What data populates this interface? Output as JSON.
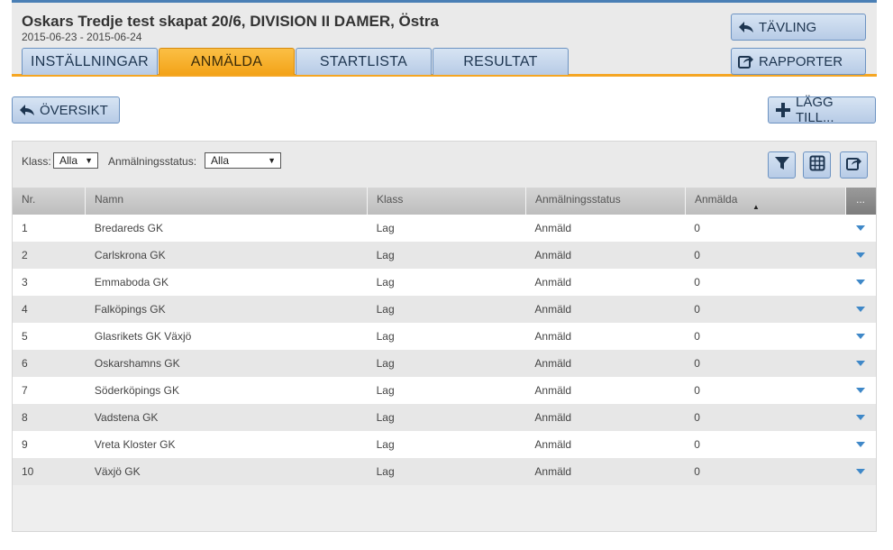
{
  "header": {
    "title": "Oskars Tredje test skapat 20/6, DIVISION II DAMER, Östra",
    "dates": "2015-06-23 - 2015-06-24",
    "tabs": [
      {
        "label": "INSTÄLLNINGAR",
        "active": false
      },
      {
        "label": "ANMÄLDA",
        "active": true
      },
      {
        "label": "STARTLISTA",
        "active": false
      },
      {
        "label": "RESULTAT",
        "active": false
      }
    ],
    "tavling_label": "TÄVLING",
    "rapporter_label": "RAPPORTER"
  },
  "actions": {
    "oversikt_label": "ÖVERSIKT",
    "lagg_till_label": "LÄGG TILL..."
  },
  "filters": {
    "klass_label": "Klass:",
    "klass_value": "Alla",
    "status_label": "Anmälningsstatus:",
    "status_value": "Alla"
  },
  "table": {
    "columns": [
      "Nr.",
      "Namn",
      "Klass",
      "Anmälningsstatus",
      "Anmälda",
      "..."
    ],
    "rows": [
      [
        "1",
        "Bredareds GK",
        "Lag",
        "Anmäld",
        "0"
      ],
      [
        "2",
        "Carlskrona GK",
        "Lag",
        "Anmäld",
        "0"
      ],
      [
        "3",
        "Emmaboda GK",
        "Lag",
        "Anmäld",
        "0"
      ],
      [
        "4",
        "Falköpings GK",
        "Lag",
        "Anmäld",
        "0"
      ],
      [
        "5",
        "Glasrikets GK Växjö",
        "Lag",
        "Anmäld",
        "0"
      ],
      [
        "6",
        "Oskarshamns GK",
        "Lag",
        "Anmäld",
        "0"
      ],
      [
        "7",
        "Söderköpings GK",
        "Lag",
        "Anmäld",
        "0"
      ],
      [
        "8",
        "Vadstena GK",
        "Lag",
        "Anmäld",
        "0"
      ],
      [
        "9",
        "Vreta Kloster GK",
        "Lag",
        "Anmäld",
        "0"
      ],
      [
        "10",
        "Växjö GK",
        "Lag",
        "Anmäld",
        "0"
      ]
    ]
  },
  "colors": {
    "accent_orange": "#f5a623",
    "button_blue": "#b7cbe6",
    "row_menu_blue": "#3f88c8"
  },
  "icons": {
    "back": "back-arrow-icon",
    "report": "export-icon",
    "add": "plus-icon",
    "filter": "filter-icon",
    "columns": "grid-icon",
    "export": "export-icon",
    "row_menu": "dropdown-triangle-icon"
  }
}
